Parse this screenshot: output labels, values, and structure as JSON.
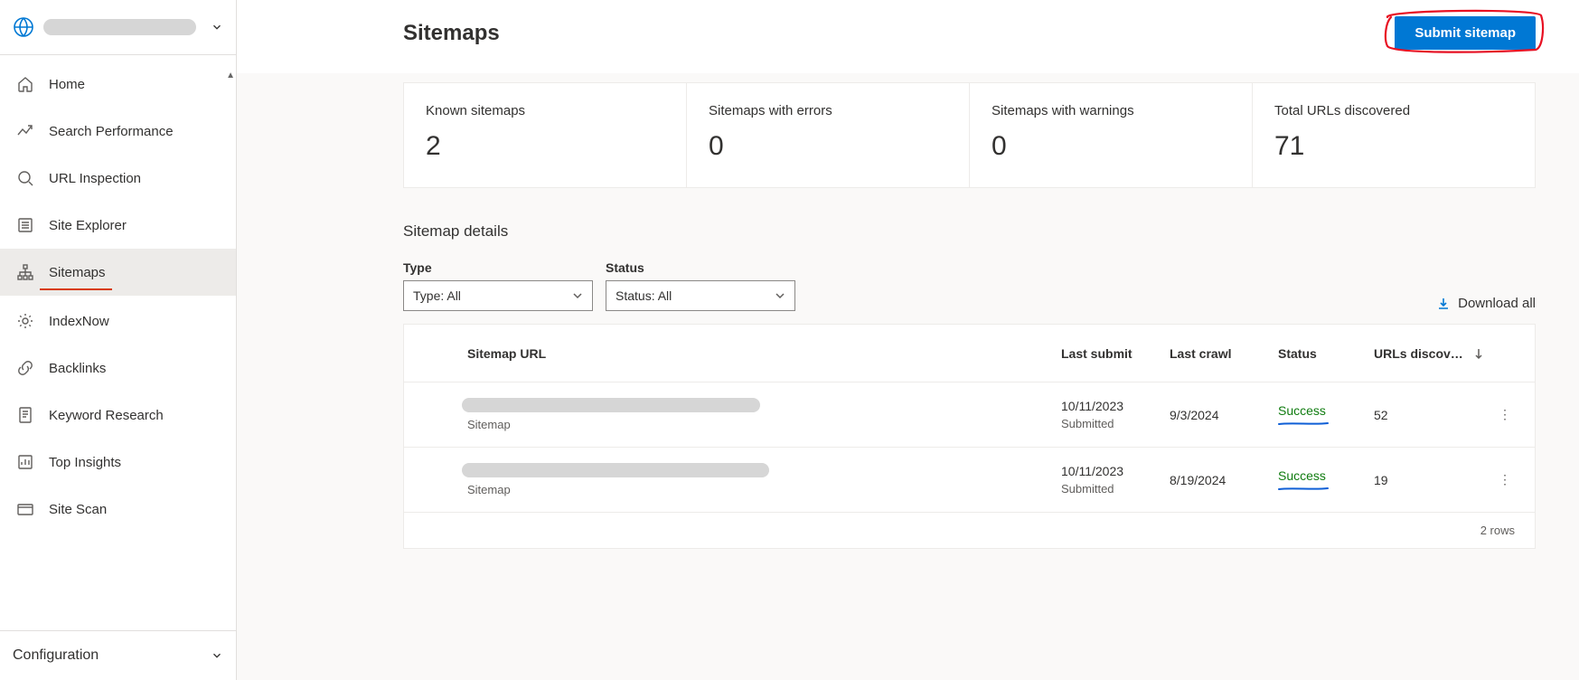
{
  "sidebar": {
    "site_name": "",
    "nav": [
      {
        "label": "Home",
        "icon": "home-icon"
      },
      {
        "label": "Search Performance",
        "icon": "trend-icon"
      },
      {
        "label": "URL Inspection",
        "icon": "search-icon"
      },
      {
        "label": "Site Explorer",
        "icon": "list-icon"
      },
      {
        "label": "Sitemaps",
        "icon": "sitemap-icon",
        "active": true
      },
      {
        "label": "IndexNow",
        "icon": "gear-icon"
      },
      {
        "label": "Backlinks",
        "icon": "link-icon"
      },
      {
        "label": "Keyword Research",
        "icon": "doc-icon"
      },
      {
        "label": "Top Insights",
        "icon": "insights-icon"
      },
      {
        "label": "Site Scan",
        "icon": "scan-icon"
      }
    ],
    "config_label": "Configuration"
  },
  "header": {
    "title": "Sitemaps",
    "submit_label": "Submit sitemap"
  },
  "stats": [
    {
      "label": "Known sitemaps",
      "value": "2"
    },
    {
      "label": "Sitemaps with errors",
      "value": "0"
    },
    {
      "label": "Sitemaps with warnings",
      "value": "0"
    },
    {
      "label": "Total URLs discovered",
      "value": "71"
    }
  ],
  "details": {
    "title": "Sitemap details",
    "filters": {
      "type_label": "Type",
      "type_value": "Type: All",
      "status_label": "Status",
      "status_value": "Status: All"
    },
    "download_label": "Download all",
    "columns": {
      "url": "Sitemap URL",
      "last_submit": "Last submit",
      "last_crawl": "Last crawl",
      "status": "Status",
      "urls": "URLs discov…"
    },
    "rows": [
      {
        "url": "",
        "sub": "Sitemap",
        "last_submit": "10/11/2023",
        "submit_note": "Submitted",
        "last_crawl": "9/3/2024",
        "status": "Success",
        "urls": "52"
      },
      {
        "url": "",
        "sub": "Sitemap",
        "last_submit": "10/11/2023",
        "submit_note": "Submitted",
        "last_crawl": "8/19/2024",
        "status": "Success",
        "urls": "19"
      }
    ],
    "footer": "2 rows"
  }
}
